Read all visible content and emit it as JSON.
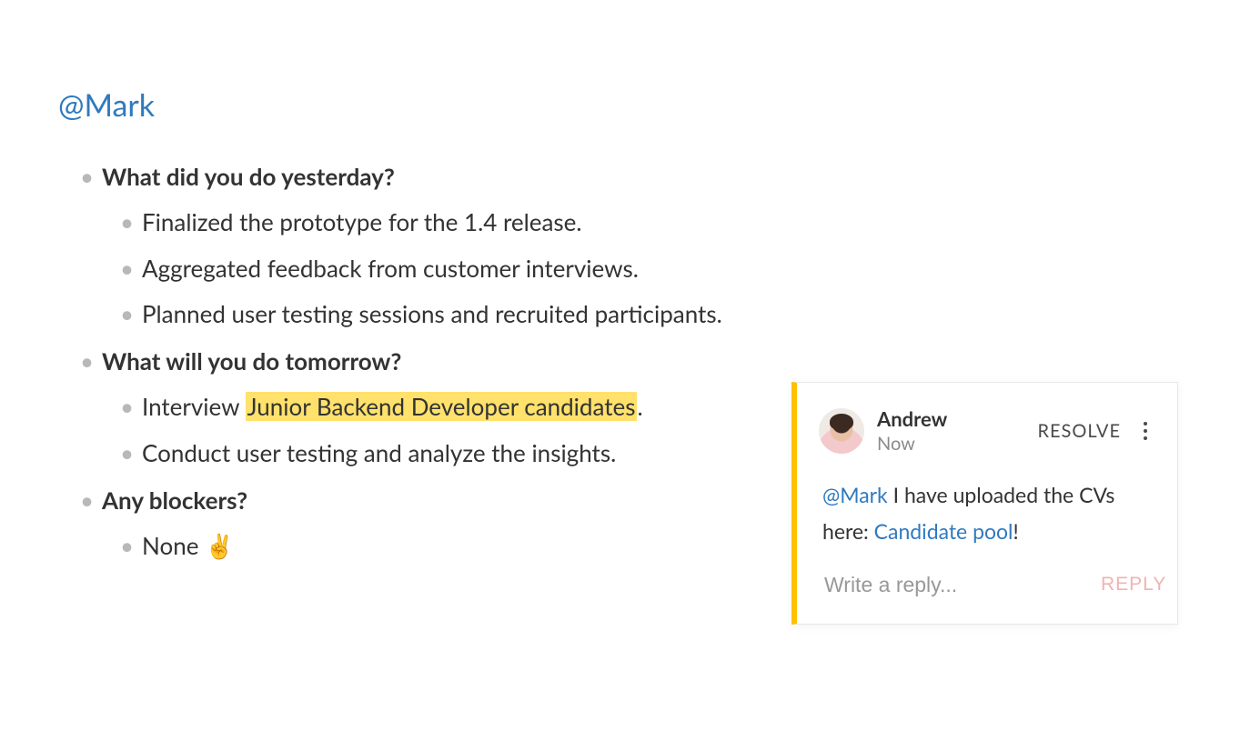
{
  "mentionTitle": "@Mark",
  "sections": {
    "s0": {
      "title": "What did you do yesterday?",
      "items": {
        "i0": "Finalized the prototype for the 1.4 release.",
        "i1": "Aggregated feedback from customer interviews.",
        "i2": "Planned user testing sessions and recruited participants."
      }
    },
    "s1": {
      "title": "What will you do tomorrow?",
      "interview": {
        "prefix": "Interview ",
        "highlight": "Junior Backend Developer candidates",
        "suffix": "."
      },
      "items": {
        "i1": "Conduct user testing and analyze the insights."
      }
    },
    "s2": {
      "title": "Any blockers?",
      "items": {
        "i0": "None ✌️"
      }
    }
  },
  "comment": {
    "author": "Andrew",
    "time": "Now",
    "resolveLabel": "RESOLVE",
    "body": {
      "mention": "@Mark",
      "text1": " I have uploaded the CVs here: ",
      "linkText": "Candidate pool",
      "text2": "!"
    },
    "replyPlaceholder": "Write a reply...",
    "replyLabel": "REPLY"
  }
}
